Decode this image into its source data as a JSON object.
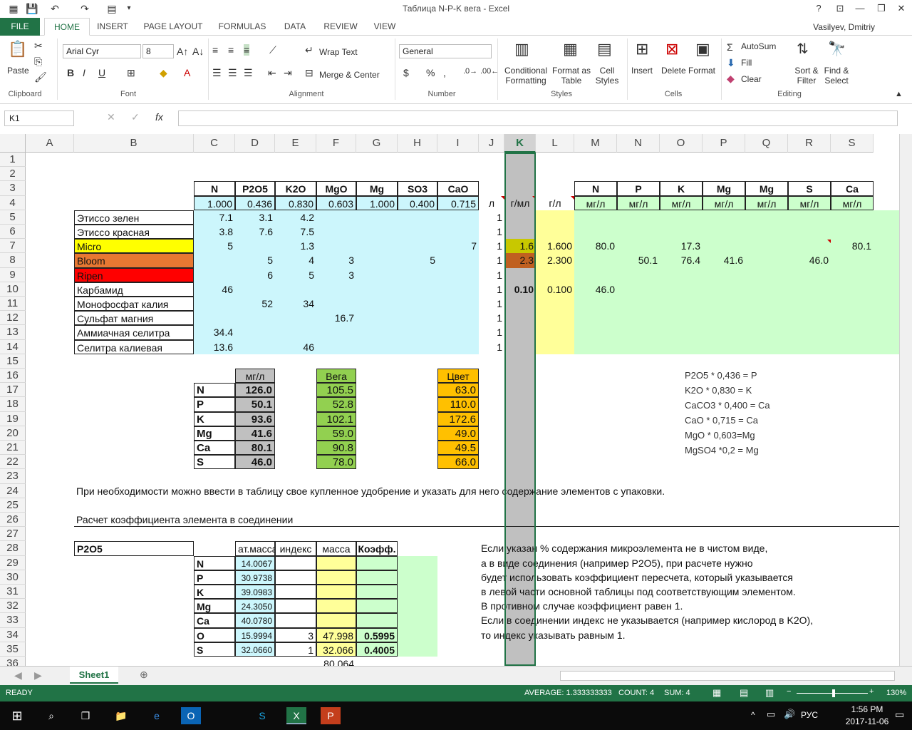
{
  "window": {
    "title": "Таблица N-P-K вега - Excel",
    "user": "Vasilyev, Dmitriy"
  },
  "ribbon": {
    "tabs": [
      "FILE",
      "HOME",
      "INSERT",
      "PAGE LAYOUT",
      "FORMULAS",
      "DATA",
      "REVIEW",
      "VIEW"
    ],
    "font_name": "Arial Cyr",
    "font_size": "8",
    "number_format": "General",
    "paste": "Paste",
    "wrap_text": "Wrap Text",
    "merge_center": "Merge & Center",
    "conditional": [
      "Conditional",
      "Formatting"
    ],
    "format_table": [
      "Format as",
      "Table"
    ],
    "cell_styles": [
      "Cell",
      "Styles"
    ],
    "insert": "Insert",
    "delete": "Delete",
    "format": "Format",
    "autosum": "AutoSum",
    "fill": "Fill",
    "clear": "Clear",
    "sort": [
      "Sort &",
      "Filter"
    ],
    "find": [
      "Find &",
      "Select"
    ],
    "groups": [
      "Clipboard",
      "Font",
      "Alignment",
      "Number",
      "Styles",
      "Cells",
      "Editing"
    ]
  },
  "formula_bar": {
    "name_box": "K1",
    "formula": ""
  },
  "columns": [
    "A",
    "B",
    "C",
    "D",
    "E",
    "F",
    "G",
    "H",
    "I",
    "J",
    "K",
    "L",
    "M",
    "N",
    "O",
    "P",
    "Q",
    "R",
    "S"
  ],
  "rows": [
    "1",
    "2",
    "3",
    "4",
    "5",
    "6",
    "7",
    "8",
    "9",
    "10",
    "11",
    "12",
    "13",
    "14",
    "15",
    "16",
    "17",
    "18",
    "19",
    "20",
    "21",
    "22",
    "23",
    "24",
    "25",
    "26",
    "27",
    "28",
    "29",
    "30",
    "31",
    "32",
    "33",
    "34",
    "35",
    "36"
  ],
  "table1": {
    "headers": [
      "N",
      "P2O5",
      "K2O",
      "MgO",
      "Mg",
      "SO3",
      "CaO"
    ],
    "coefs": [
      "1.000",
      "0.436",
      "0.830",
      "0.603",
      "1.000",
      "0.400",
      "0.715"
    ],
    "unit_j": "л",
    "unit_k": "г/мл",
    "unit_l": "г/л",
    "right_headers": [
      "N",
      "P",
      "K",
      "Mg",
      "Mg",
      "S",
      "Ca"
    ],
    "right_units": [
      "мг/л",
      "мг/л",
      "мг/л",
      "мг/л",
      "мг/л",
      "мг/л",
      "мг/л"
    ],
    "names": [
      "Этиссо зелен",
      "Этиссо красная",
      "Micro",
      "Bloom",
      "Ripen",
      "Карбамид",
      "Монофосфат калия",
      "Сульфат магния",
      "Аммиачная селитра",
      "Селитра калиевая"
    ],
    "C": [
      "7.1",
      "3.8",
      "5",
      "",
      "",
      "46",
      "",
      "",
      "34.4",
      "13.6"
    ],
    "D": [
      "3.1",
      "7.6",
      "",
      "5",
      "6",
      "",
      "52",
      "",
      "",
      ""
    ],
    "E": [
      "4.2",
      "7.5",
      "1.3",
      "4",
      "5",
      "",
      "34",
      "",
      "",
      "46"
    ],
    "F": [
      "",
      "",
      "",
      "3",
      "3",
      "",
      "",
      "16.7",
      "",
      ""
    ],
    "H": [
      "",
      "",
      "",
      "5",
      "",
      "",
      "",
      "",
      "",
      ""
    ],
    "I": [
      "",
      "",
      "7",
      "",
      "",
      "",
      "",
      "",
      "",
      ""
    ],
    "J": [
      "1",
      "1",
      "1",
      "1",
      "1",
      "1",
      "1",
      "1",
      "1",
      "1"
    ],
    "K": [
      "",
      "",
      "1.6",
      "2.3",
      "",
      "0.10",
      "",
      "",
      "",
      ""
    ],
    "L": [
      "",
      "",
      "1.600",
      "2.300",
      "",
      "0.100",
      "",
      "",
      "",
      ""
    ],
    "M": [
      "",
      "",
      "80.0",
      "",
      "",
      "46.0",
      "",
      "",
      "",
      ""
    ],
    "N": [
      "",
      "",
      "",
      "50.1",
      "",
      "",
      "",
      "",
      "",
      ""
    ],
    "O": [
      "",
      "",
      "17.3",
      "76.4",
      "",
      "",
      "",
      "",
      "",
      ""
    ],
    "P": [
      "",
      "",
      "",
      "41.6",
      "",
      "",
      "",
      "",
      "",
      ""
    ],
    "R": [
      "",
      "",
      "",
      "46.0",
      "",
      "",
      "",
      "",
      "",
      ""
    ],
    "S": [
      "",
      "",
      "80.1",
      "",
      "",
      "",
      "",
      "",
      "",
      ""
    ]
  },
  "summary": {
    "h_mgl": "мг/л",
    "h_vega": "Вега",
    "h_cvet": "Цвет",
    "elements": [
      "N",
      "P",
      "K",
      "Mg",
      "Ca",
      "S"
    ],
    "mgl": [
      "126.0",
      "50.1",
      "93.6",
      "41.6",
      "80.1",
      "46.0"
    ],
    "vega": [
      "105.5",
      "52.8",
      "102.1",
      "59.0",
      "90.8",
      "78.0"
    ],
    "cvet": [
      "63.0",
      "110.0",
      "172.6",
      "49.0",
      "49.5",
      "66.0"
    ]
  },
  "formulas_note": [
    "P2O5 * 0,436 = P",
    "K2O * 0,830 = K",
    "CaCO3 * 0,400 = Ca",
    "CaO * 0,715 = Ca",
    "MgO * 0,603=Mg",
    "MgSO4 *0,2 = Mg"
  ],
  "note24": "При необходимости можно ввести в таблицу свое купленное удобрение и указать для него содержание элементов с упаковки.",
  "note26": "Расчет коэффициента элемента в соединении",
  "calc": {
    "compound": "P2O5",
    "h_mass_at": "ат.масса",
    "h_index": "индекс",
    "h_mass": "масса",
    "h_coef": "Коэфф.",
    "elements": [
      "N",
      "P",
      "K",
      "Mg",
      "Ca",
      "O",
      "S"
    ],
    "atomic": [
      "14.0067",
      "30.9738",
      "39.0983",
      "24.3050",
      "40.0780",
      "15.9994",
      "32.0660"
    ],
    "index": [
      "",
      "",
      "",
      "",
      "",
      "3",
      "1"
    ],
    "mass": [
      "",
      "",
      "",
      "",
      "",
      "47.998",
      "32.066"
    ],
    "coef": [
      "",
      "",
      "",
      "",
      "",
      "0.5995",
      "0.4005"
    ],
    "total": "80.064"
  },
  "explain": [
    "Если указан % содержания микроэлемента не в чистом виде,",
    "а в виде соединения (например P2O5), при расчете нужно",
    "будет использовать коэффициент пересчета, который указывается",
    "в левой части основной таблицы под соответствующим элементом.",
    "В противном случае коэффициент равен 1.",
    "Если в соединении индекс не указывается (например кислород в K2O),",
    "то индекс указывать равным 1."
  ],
  "sheet_tab": "Sheet1",
  "status": {
    "ready": "READY",
    "average": "AVERAGE: 1.333333333",
    "count": "COUNT: 4",
    "sum": "SUM: 4",
    "zoom": "130%"
  },
  "taskbar": {
    "time": "1:56 PM",
    "date": "2017-11-06",
    "lang": "РУС"
  },
  "colors": {
    "excel_green": "#217346",
    "cyan": "#ccf6fc",
    "yellow": "#ffff99",
    "green": "#ccffcc",
    "gray": "#c0c0c0",
    "micro": "#ffff00",
    "bloom": "#e87832",
    "ripen": "#ff0000",
    "vega": "#92d050",
    "cvet": "#ffc000"
  }
}
